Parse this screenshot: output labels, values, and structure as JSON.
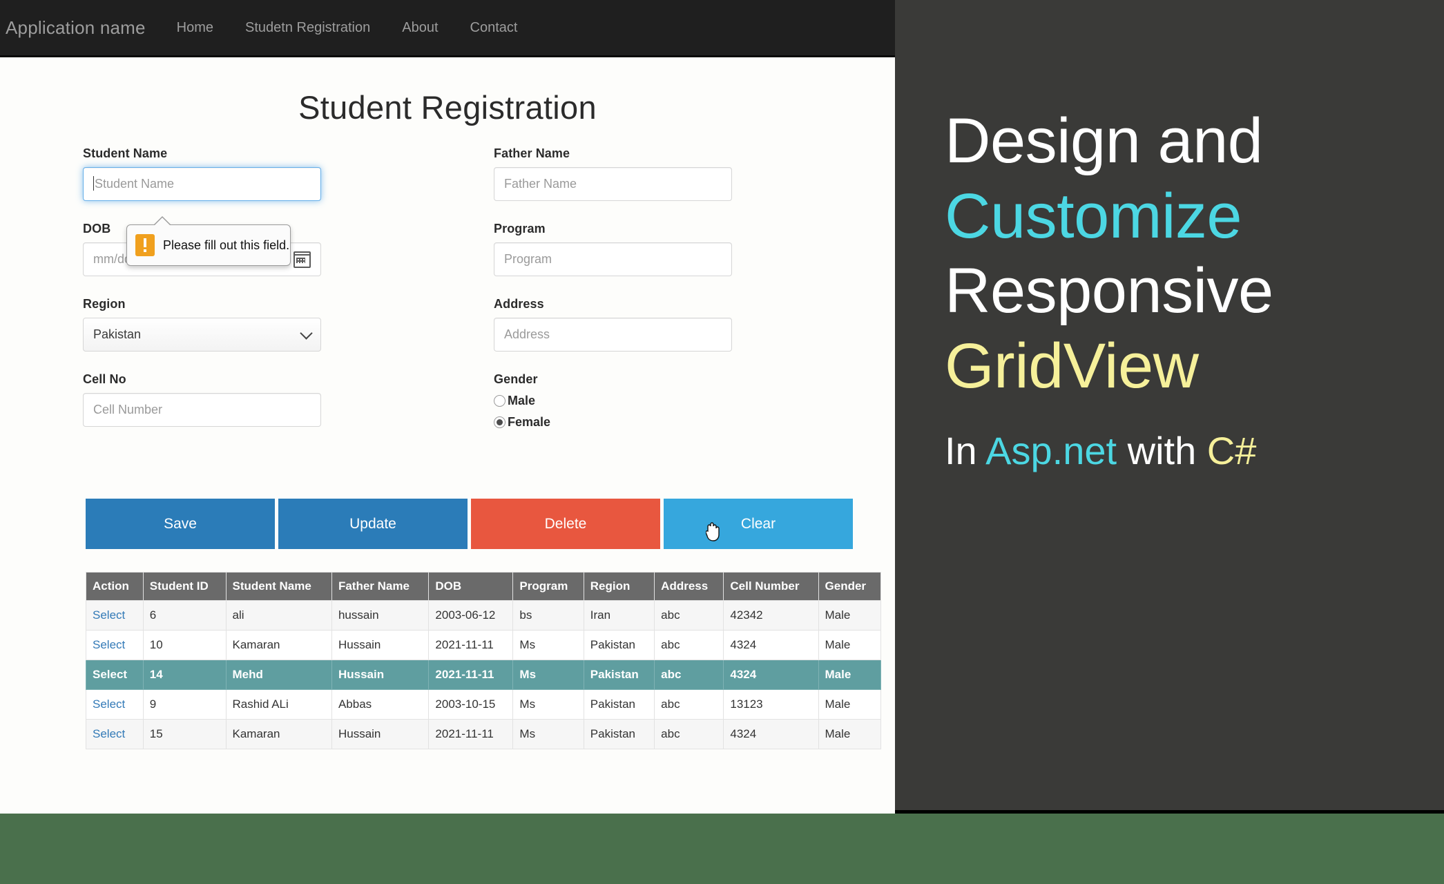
{
  "navbar": {
    "brand": "Application name",
    "links": [
      {
        "label": "Home"
      },
      {
        "label": "Studetn Registration"
      },
      {
        "label": "About"
      },
      {
        "label": "Contact"
      }
    ]
  },
  "page": {
    "title": "Student Registration"
  },
  "form": {
    "student_name": {
      "label": "Student Name",
      "placeholder": "Student Name",
      "value": ""
    },
    "dob": {
      "label": "DOB",
      "placeholder": "mm/dd/yyyy",
      "value": "",
      "icon": "calendar-icon"
    },
    "region": {
      "label": "Region",
      "value": "Pakistan",
      "icon": "chevron-down-icon"
    },
    "cell_no": {
      "label": "Cell No",
      "placeholder": "Cell Number",
      "value": ""
    },
    "father_name": {
      "label": "Father Name",
      "placeholder": "Father Name",
      "value": ""
    },
    "program": {
      "label": "Program",
      "placeholder": "Program",
      "value": ""
    },
    "address": {
      "label": "Address",
      "placeholder": "Address",
      "value": ""
    },
    "gender": {
      "label": "Gender",
      "options": [
        {
          "label": "Male",
          "checked": false
        },
        {
          "label": "Female",
          "checked": true
        }
      ]
    }
  },
  "tooltip": {
    "message": "Please fill out this field.",
    "icon": "warning-icon"
  },
  "buttons": [
    {
      "label": "Save",
      "color": "#2b7cb8"
    },
    {
      "label": "Update",
      "color": "#2b7cb8"
    },
    {
      "label": "Delete",
      "color": "#e8573f"
    },
    {
      "label": "Clear",
      "color": "#36a7dd"
    }
  ],
  "grid": {
    "columns": [
      "Action",
      "Student ID",
      "Student Name",
      "Father Name",
      "DOB",
      "Program",
      "Region",
      "Address",
      "Cell Number",
      "Gender"
    ],
    "action_label": "Select",
    "selected_row_index": 2,
    "header_bg": "#6a6a6a",
    "selected_bg": "#5f9ea0",
    "rows": [
      {
        "action": "Select",
        "student_id": "6",
        "student_name": "ali",
        "father_name": "hussain",
        "dob": "2003-06-12",
        "program": "bs",
        "region": "Iran",
        "address": "abc",
        "cell_number": "42342",
        "gender": "Male"
      },
      {
        "action": "Select",
        "student_id": "10",
        "student_name": "Kamaran",
        "father_name": "Hussain",
        "dob": "2021-11-11",
        "program": "Ms",
        "region": "Pakistan",
        "address": "abc",
        "cell_number": "4324",
        "gender": "Male"
      },
      {
        "action": "Select",
        "student_id": "14",
        "student_name": "Mehd",
        "father_name": "Hussain",
        "dob": "2021-11-11",
        "program": "Ms",
        "region": "Pakistan",
        "address": "abc",
        "cell_number": "4324",
        "gender": "Male"
      },
      {
        "action": "Select",
        "student_id": "9",
        "student_name": "Rashid ALi",
        "father_name": "Abbas",
        "dob": "2003-10-15",
        "program": "Ms",
        "region": "Pakistan",
        "address": "abc",
        "cell_number": "13123",
        "gender": "Male"
      },
      {
        "action": "Select",
        "student_id": "15",
        "student_name": "Kamaran",
        "father_name": "Hussain",
        "dob": "2021-11-11",
        "program": "Ms",
        "region": "Pakistan",
        "address": "abc",
        "cell_number": "4324",
        "gender": "Male"
      }
    ]
  },
  "panel": {
    "line1": "Design and",
    "line2": "Customize",
    "line3": "Responsive",
    "line4": " GridView",
    "line5_a": "In ",
    "line5_b": "Asp.net",
    "line5_c": " with ",
    "line5_d": "C#",
    "accent_cyan": "#4cd7e3",
    "accent_yellow": "#f6f09a",
    "background": "#3a3a38"
  }
}
